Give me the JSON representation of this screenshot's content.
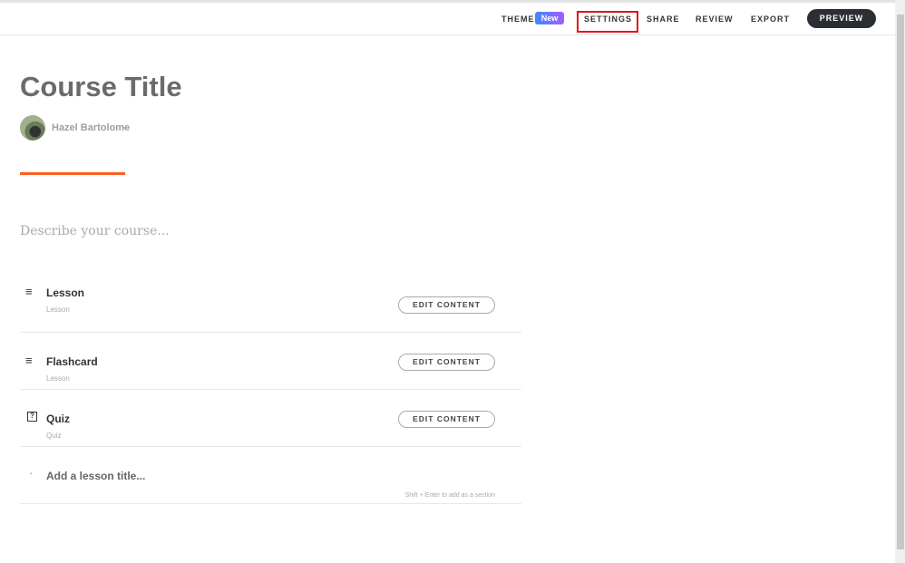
{
  "header": {
    "theme": "THEME",
    "theme_badge": "New",
    "settings": "SETTINGS",
    "share": "SHARE",
    "review": "REVIEW",
    "export": "EXPORT",
    "preview": "PREVIEW"
  },
  "course": {
    "title": "Course Title",
    "author": "Hazel Bartolome",
    "description_placeholder": "Describe your course..."
  },
  "lessons": [
    {
      "title": "Lesson",
      "type": "Lesson",
      "icon": "lines-icon",
      "button": "EDIT CONTENT"
    },
    {
      "title": "Flashcard",
      "type": "Lesson",
      "icon": "lines-icon",
      "button": "EDIT CONTENT"
    },
    {
      "title": "Quiz",
      "type": "Quiz",
      "icon": "question-box-icon",
      "button": "EDIT CONTENT"
    }
  ],
  "new_lesson": {
    "placeholder": "Add a lesson title...",
    "hint": "Shift + Enter to add as a section"
  },
  "colors": {
    "accent": "#ff5f1f",
    "highlight": "#e0141e",
    "preview_bg": "#2b2f33"
  }
}
